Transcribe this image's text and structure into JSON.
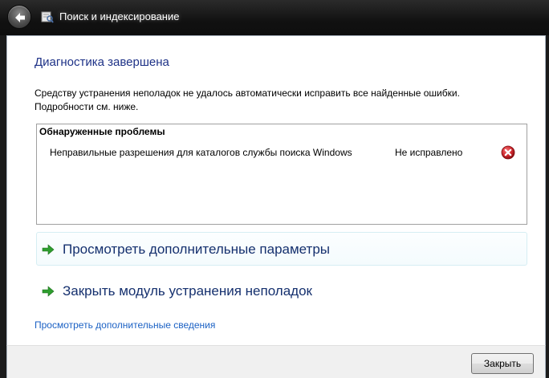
{
  "window": {
    "title": "Поиск и индексирование",
    "back_icon": "back-arrow-icon",
    "app_icon": "search-indexing-icon"
  },
  "main": {
    "heading": "Диагностика завершена",
    "description": "Средству устранения неполадок не удалось автоматически исправить все найденные ошибки. Подробности см. ниже.",
    "problems": {
      "header": "Обнаруженные проблемы",
      "items": [
        {
          "text": "Неправильные разрешения для каталогов службы поиска Windows",
          "status": "Не исправлено",
          "icon": "error-icon"
        }
      ]
    },
    "commands": [
      {
        "label": "Просмотреть дополнительные параметры",
        "icon": "green-arrow-icon"
      },
      {
        "label": "Закрыть модуль устранения неполадок",
        "icon": "green-arrow-icon"
      }
    ],
    "more_details_link": "Просмотреть дополнительные сведения"
  },
  "footer": {
    "close_label": "Закрыть"
  },
  "colors": {
    "heading": "#1e3287",
    "link": "#1b61c4",
    "command_text": "#15306e",
    "error": "#c8202a",
    "arrow": "#2e9e2e"
  }
}
